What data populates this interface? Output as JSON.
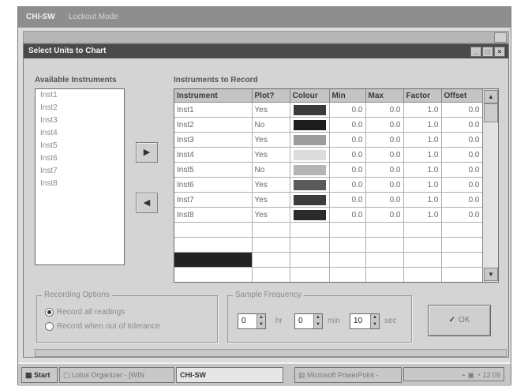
{
  "bg_window": {
    "title": "CHI-SW",
    "subtitle": "Lockout Mode"
  },
  "dialog": {
    "title": "Select Units to Chart",
    "window_buttons": [
      "_",
      "□",
      "×"
    ]
  },
  "available": {
    "label": "Available Instruments",
    "items": [
      "Inst1",
      "Inst2",
      "Inst3",
      "Inst4",
      "Inst5",
      "Inst6",
      "Inst7",
      "Inst8"
    ]
  },
  "buttons": {
    "add_icon": "right-arrow-icon",
    "remove_icon": "left-arrow-icon",
    "ok_label": "OK",
    "ok_icon": "checkmark-icon"
  },
  "record": {
    "label": "Instruments to Record",
    "columns": [
      "Instrument",
      "Plot?",
      "Colour",
      "Min",
      "Max",
      "Factor",
      "Offset"
    ],
    "rows": [
      {
        "inst": "Inst1",
        "plot": "Yes",
        "colour": "#3a3a3a",
        "min": "0.0",
        "max": "0.0",
        "factor": "1.0",
        "offset": "0.0"
      },
      {
        "inst": "Inst2",
        "plot": "No",
        "colour": "#1c1c1c",
        "min": "0.0",
        "max": "0.0",
        "factor": "1.0",
        "offset": "0.0"
      },
      {
        "inst": "Inst3",
        "plot": "Yes",
        "colour": "#9c9c9c",
        "min": "0.0",
        "max": "0.0",
        "factor": "1.0",
        "offset": "0.0"
      },
      {
        "inst": "Inst4",
        "plot": "Yes",
        "colour": "#dcdcdc",
        "min": "0.0",
        "max": "0.0",
        "factor": "1.0",
        "offset": "0.0"
      },
      {
        "inst": "Inst5",
        "plot": "No",
        "colour": "#b4b4b4",
        "min": "0.0",
        "max": "0.0",
        "factor": "1.0",
        "offset": "0.0"
      },
      {
        "inst": "Inst6",
        "plot": "Yes",
        "colour": "#5a5a5a",
        "min": "0.0",
        "max": "0.0",
        "factor": "1.0",
        "offset": "0.0"
      },
      {
        "inst": "Inst7",
        "plot": "Yes",
        "colour": "#3c3c3c",
        "min": "0.0",
        "max": "0.0",
        "factor": "1.0",
        "offset": "0.0"
      },
      {
        "inst": "Inst8",
        "plot": "Yes",
        "colour": "#2a2a2a",
        "min": "0.0",
        "max": "0.0",
        "factor": "1.0",
        "offset": "0.0"
      }
    ]
  },
  "recording_options": {
    "label": "Recording Options",
    "opt_all": "Record all readings",
    "opt_tol": "Record when out of tolerance",
    "selected": "opt_all"
  },
  "sample_frequency": {
    "label": "Sample Frequency",
    "hrs": "0",
    "hrs_unit": "hr",
    "min": "0",
    "min_unit": "min",
    "sec": "10",
    "sec_unit": "sec"
  },
  "taskbar": {
    "start": "Start",
    "lotus": "Lotus Organizer - [WIN",
    "chisw": "CHI-SW",
    "ppt": "Microsoft PowerPoint -",
    "clock": "12:09"
  }
}
